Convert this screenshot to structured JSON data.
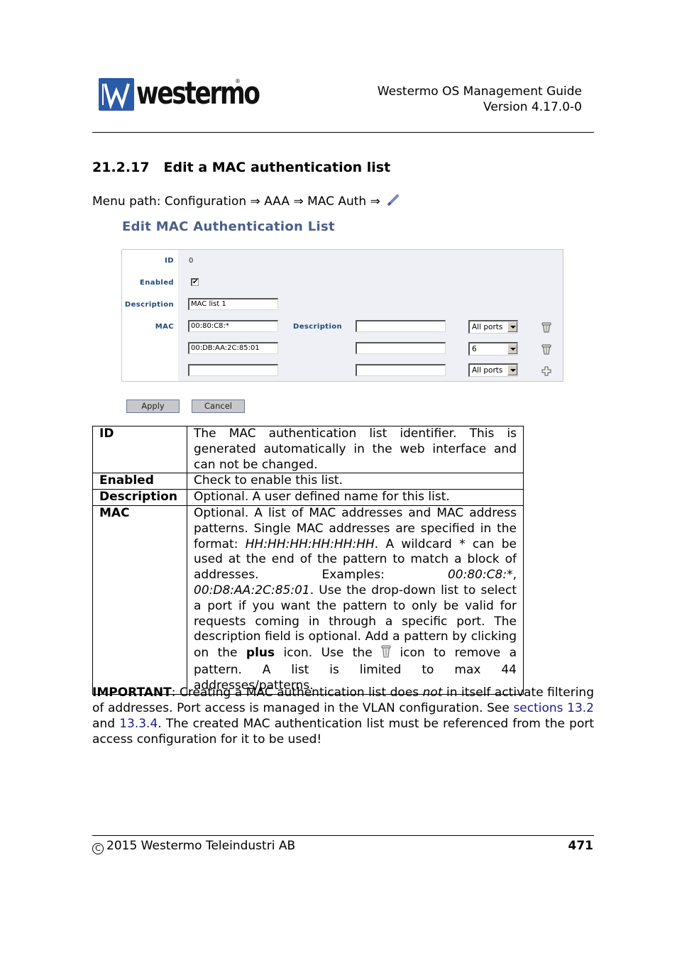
{
  "header": {
    "logo_text": "westermo",
    "logo_mark": "W",
    "registered": "®",
    "guide_title": "Westermo OS Management Guide",
    "version": "Version 4.17.0-0"
  },
  "section": {
    "number": "21.2.17",
    "title": "Edit a MAC authentication list",
    "menu_path": "Menu path: Configuration ⇒ AAA ⇒ MAC Auth ⇒",
    "menu_icon": "pencil-icon"
  },
  "ui": {
    "title": "Edit MAC Authentication List",
    "fields": {
      "id_label": "ID",
      "id_value": "0",
      "enabled_label": "Enabled",
      "enabled_checked": true,
      "enabled_mark": "✔",
      "description_label": "Description",
      "description_value": "MAC list 1",
      "mac_label": "MAC",
      "mac_description_label": "Description"
    },
    "mac_rows": [
      {
        "mac": "00:80:C8:*",
        "description": "",
        "port": "All ports",
        "action_icon": "trash-icon"
      },
      {
        "mac": "00:DB:AA:2C:85:01",
        "description": "",
        "port": "6",
        "action_icon": "trash-icon"
      },
      {
        "mac": "",
        "description": "",
        "port": "All ports",
        "action_icon": "plus-icon"
      }
    ],
    "buttons": {
      "apply": "Apply",
      "cancel": "Cancel"
    }
  },
  "desc_table": {
    "rows": [
      {
        "key": "ID",
        "value": "The MAC authentication list identifier. This is generated automatically in the web interface and can not be changed."
      },
      {
        "key": "Enabled",
        "value": "Check to enable this list."
      },
      {
        "key": "Description",
        "value": "Optional. A user defined name for this list."
      }
    ],
    "mac": {
      "key": "MAC",
      "p1": "Optional.  A list of MAC addresses and MAC address patterns.  Single MAC addresses are specified in the format: ",
      "format": "HH:HH:HH:HH:HH:HH",
      "p2": ". A wildcard * can be used at the end of the pattern to match a block of addresses. Examples: ",
      "ex1": "00:80:C8:*",
      "p3": ", ",
      "ex2": "00:D8:AA:2C:85:01",
      "p4": ". Use the drop-down list to select a port if you want the pattern to only be valid for requests coming in through a specific port. The description field is optional.  Add a pattern by clicking on the ",
      "plus_word": "plus",
      "p5": " icon.  Use the ",
      "p6": " icon to remove a pattern. A list is limited to max 44 addresses/patterns."
    }
  },
  "important": {
    "label": "IMPORTANT",
    "t1": ": Creating a MAC authentication list does ",
    "not": "not",
    "t2": " in itself activate filtering of addresses.  Port access is managed in the VLAN configuration.  See ",
    "link1": "sections 13.2",
    "t3": " and  ",
    "link2": "13.3.4",
    "t4": ".  The created MAC authentication list must be referenced from the port access configuration for it to be used!"
  },
  "footer": {
    "copyright_symbol": "C",
    "text": "2015 Westermo Teleindustri AB",
    "page": "471"
  }
}
